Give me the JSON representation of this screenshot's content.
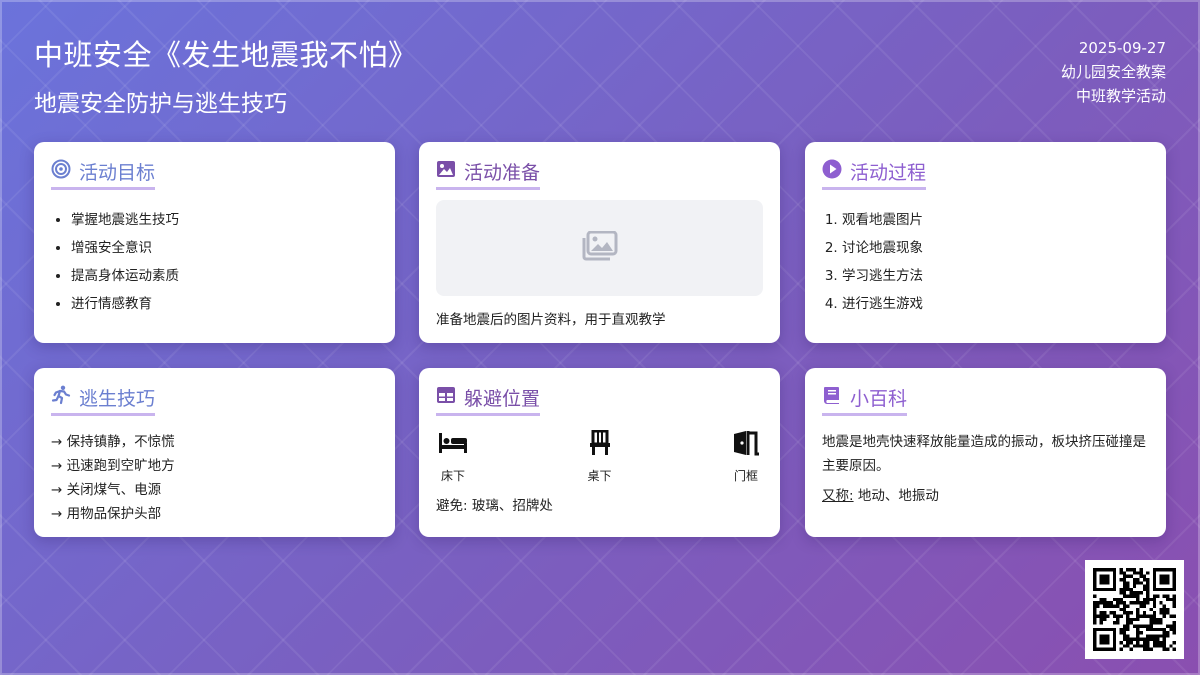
{
  "header": {
    "title": "中班安全《发生地震我不怕》",
    "subtitle": "地震安全防护与逃生技巧",
    "date": "2025-09-27",
    "category": "幼儿园安全教案",
    "activity_type": "中班教学活动"
  },
  "cards": {
    "goals": {
      "title": "活动目标",
      "icon": "target-icon",
      "items": [
        "掌握地震逃生技巧",
        "增强安全意识",
        "提高身体运动素质",
        "进行情感教育"
      ]
    },
    "prep": {
      "title": "活动准备",
      "icon": "image-icon",
      "placeholder_icon": "images-icon",
      "caption": "准备地震后的图片资料，用于直观教学"
    },
    "process": {
      "title": "活动过程",
      "icon": "play-circle-icon",
      "steps": [
        "观看地震图片",
        "讨论地震现象",
        "学习逃生方法",
        "进行逃生游戏"
      ]
    },
    "escape": {
      "title": "逃生技巧",
      "icon": "running-icon",
      "items": [
        "→ 保持镇静，不惊慌",
        "→ 迅速跑到空旷地方",
        "→ 关闭煤气、电源",
        "→ 用物品保护头部"
      ]
    },
    "shelter": {
      "title": "躲避位置",
      "icon": "table-icon",
      "spots": [
        {
          "label": "床下",
          "icon": "bed-icon"
        },
        {
          "label": "桌下",
          "icon": "chair-icon"
        },
        {
          "label": "门框",
          "icon": "door-icon"
        }
      ],
      "avoid": "避免: 玻璃、招牌处"
    },
    "wiki": {
      "title": "小百科",
      "icon": "book-icon",
      "text": "地震是地壳快速释放能量造成的振动，板块挤压碰撞是主要原因。",
      "alias_label": "又称:",
      "alias_value": "地动、地振动"
    }
  },
  "colors": {
    "accent_blue": "#6b7fd0",
    "accent_purple": "#7a4fa8",
    "accent_violet": "#8e5fd0",
    "underline": "#c9b4ee"
  }
}
